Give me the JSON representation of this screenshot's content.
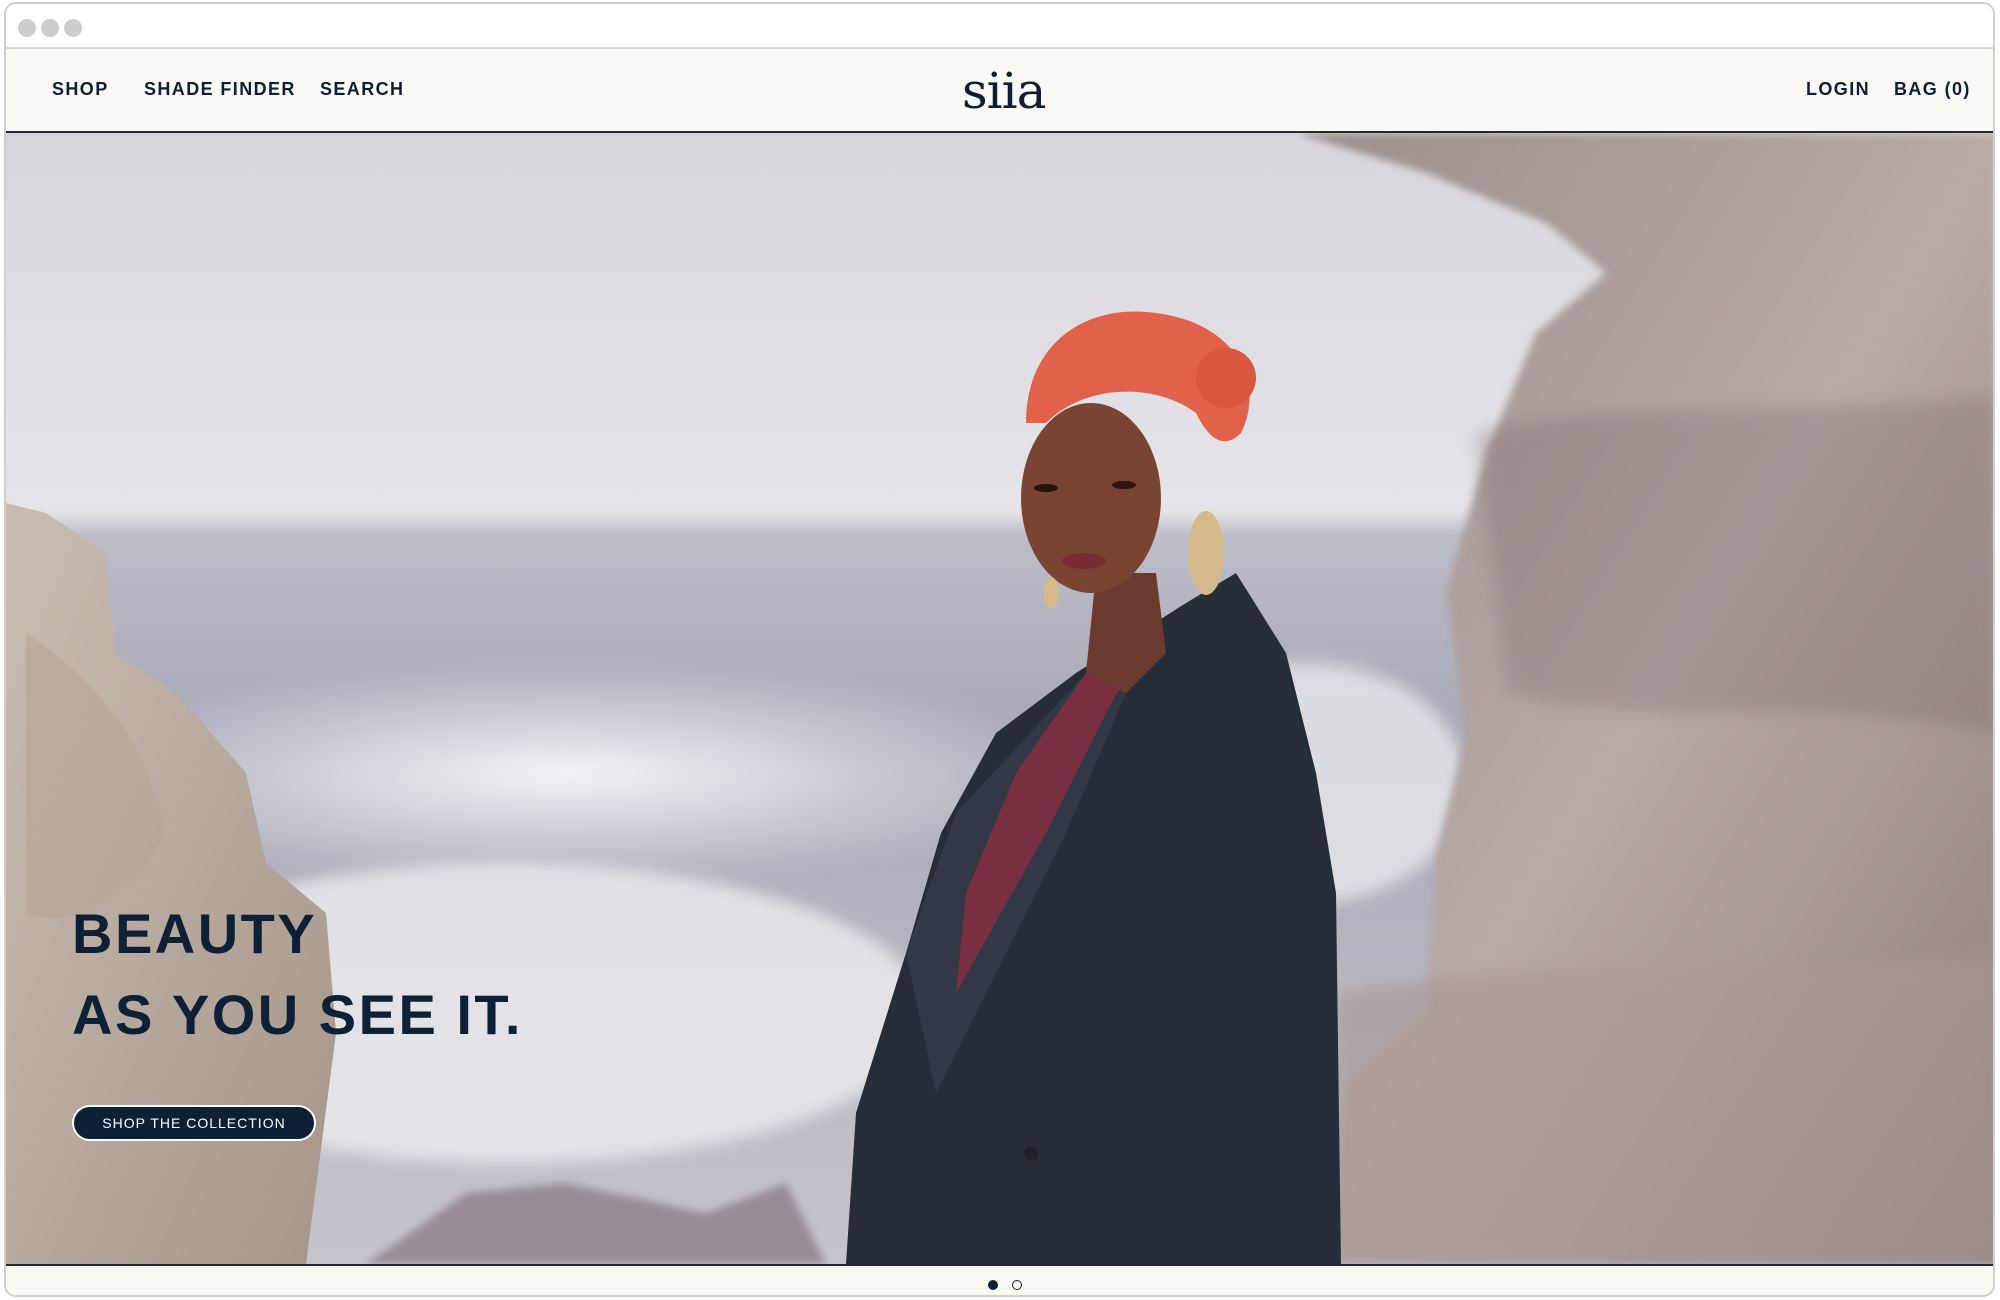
{
  "nav": {
    "left_items": [
      "SHOP",
      "SHADE FINDER",
      "SEARCH"
    ],
    "logo": "siia",
    "login": "LOGIN",
    "bag": "BAG (0)"
  },
  "hero": {
    "headline_line1": "BEAUTY",
    "headline_line2": "AS YOU SEE IT.",
    "cta": "SHOP THE COLLECTION",
    "image": "woman-in-dark-blazer-on-rocky-coast"
  },
  "carousel": {
    "slides": 2,
    "active": 1
  },
  "colors": {
    "navy": "#0d2036",
    "cream": "#faf9f4",
    "sky": "#e6e5ea",
    "rock": "#b8a8a4",
    "hair": "#e2614a"
  }
}
